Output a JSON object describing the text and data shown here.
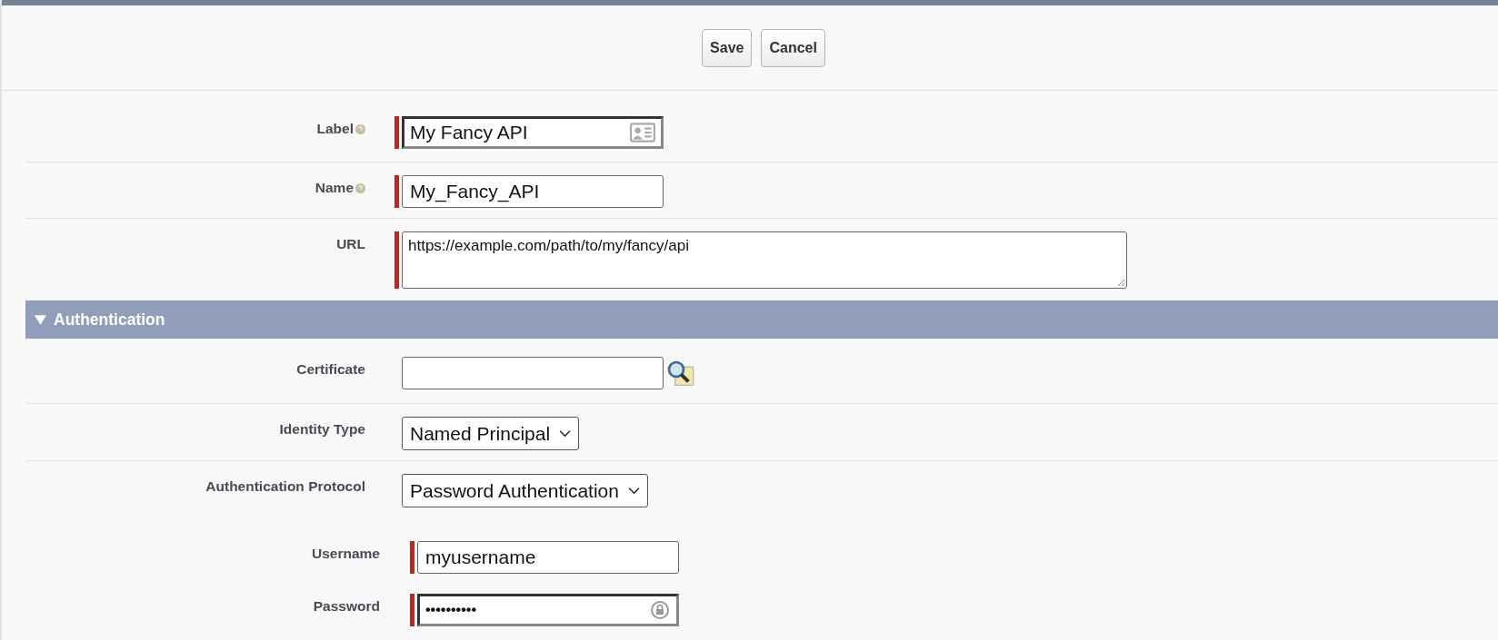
{
  "buttons": [
    {
      "label": "Save"
    },
    {
      "label": "Cancel"
    }
  ],
  "sections": [
    {
      "fields": [
        {
          "label": "Label",
          "kind": "text",
          "value": "My Fancy API",
          "required": true,
          "help": true,
          "outlined": true,
          "card_icon": true
        },
        {
          "label": "Name",
          "kind": "text",
          "value": "My_Fancy_API",
          "required": true,
          "help": true
        },
        {
          "label": "URL",
          "kind": "textarea",
          "value": "https://example.com/path/to/my/fancy/api",
          "required": true
        }
      ]
    },
    {
      "title": "Authentication",
      "expanded": true,
      "fields": [
        {
          "label": "Certificate",
          "kind": "lookup"
        },
        {
          "label": "Identity Type",
          "kind": "select",
          "value": "Named Principal"
        },
        {
          "label": "Authentication Protocol",
          "kind": "select",
          "value": "Password Authentication"
        }
      ],
      "credentials": [
        {
          "label": "Username",
          "kind": "text",
          "value": "myusername",
          "required": true
        },
        {
          "label": "Password",
          "kind": "password",
          "value": "••••••••••",
          "required": true,
          "outlined": true
        }
      ]
    }
  ]
}
